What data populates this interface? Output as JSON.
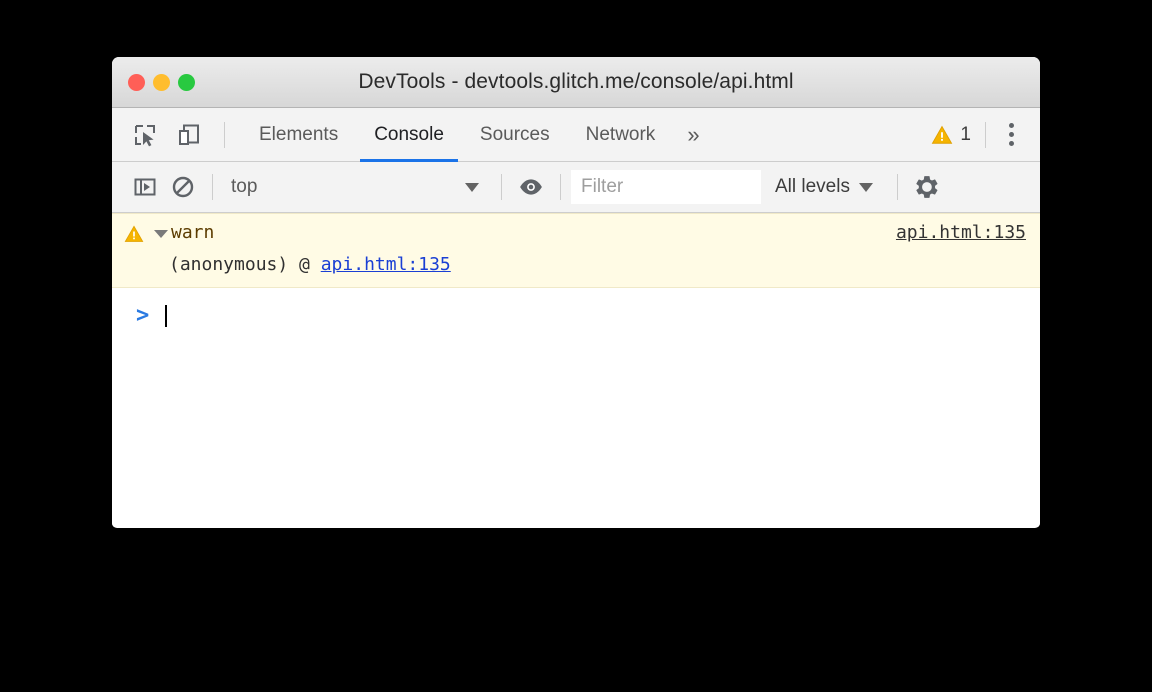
{
  "window": {
    "title": "DevTools - devtools.glitch.me/console/api.html",
    "traffic_lights": [
      {
        "name": "close",
        "color": "#ff5f57"
      },
      {
        "name": "minimize",
        "color": "#ffbd2e"
      },
      {
        "name": "zoom",
        "color": "#28c940"
      }
    ]
  },
  "tabbar": {
    "inspect_icon": "inspect-element-icon",
    "device_icon": "device-toolbar-icon",
    "tabs": [
      {
        "label": "Elements",
        "active": false
      },
      {
        "label": "Console",
        "active": true
      },
      {
        "label": "Sources",
        "active": false
      },
      {
        "label": "Network",
        "active": false
      }
    ],
    "overflow_label": "»",
    "warning_icon": "warning-triangle-icon",
    "warning_count": "1",
    "menu_icon": "kebab-menu-icon",
    "active_tab_color": "#1a73e8"
  },
  "toolbar": {
    "sidebar_icon": "show-console-sidebar-icon",
    "clear_icon": "clear-console-icon",
    "context": {
      "value": "top",
      "chevron": "chevron-down-icon"
    },
    "eye_icon": "create-live-expression-icon",
    "filter": {
      "value": "",
      "placeholder": "Filter"
    },
    "levels": {
      "label": "All levels",
      "chevron": "chevron-down-icon"
    },
    "settings_icon": "gear-icon"
  },
  "console": {
    "messages": [
      {
        "level": "warning",
        "icon": "warning-triangle-icon",
        "disclosure": "expanded",
        "text": "warn",
        "source_link": "api.html:135",
        "stack": [
          {
            "fn": "(anonymous) @ ",
            "link": "api.html:135"
          }
        ],
        "bg_color": "#fffbe5",
        "text_color": "#5c3c00"
      }
    ],
    "prompt": {
      "arrow": ">",
      "input_value": ""
    }
  }
}
